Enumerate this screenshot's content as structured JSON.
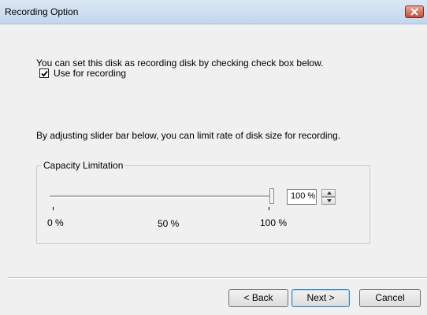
{
  "window": {
    "title": "Recording Option"
  },
  "intro_text": "You can set this disk as recording disk by checking check box below.",
  "use_for_recording": {
    "label": "Use for recording",
    "checked": true
  },
  "slider_text": "By adjusting slider bar below, you can limit rate of disk size for recording.",
  "capacity_group": {
    "legend": "Capacity Limitation",
    "slider_level_percent": 100,
    "spin_value": "100 %",
    "tick_labels": [
      "0 %",
      "50 %",
      "100 %"
    ]
  },
  "buttons": {
    "back": "< Back",
    "next": "Next >",
    "cancel": "Cancel"
  },
  "icons": {
    "close": "close-icon",
    "check": "check-icon",
    "up": "arrow-up-icon",
    "down": "arrow-down-icon"
  }
}
